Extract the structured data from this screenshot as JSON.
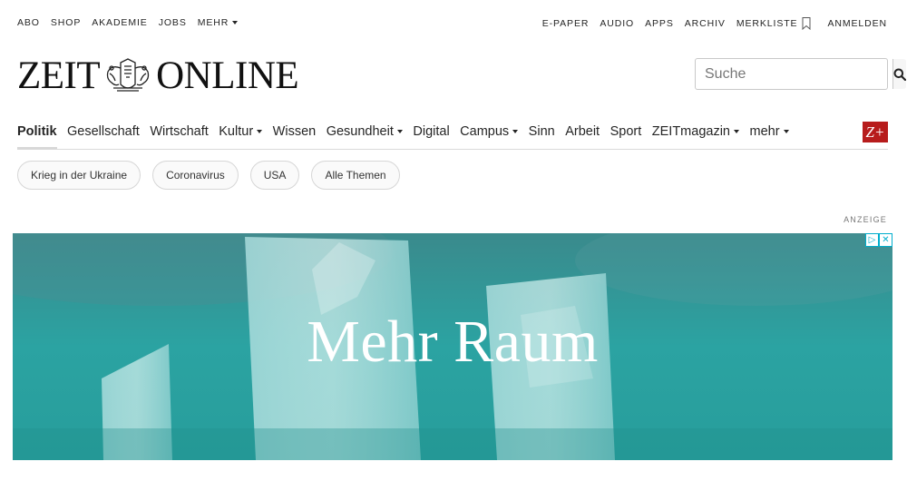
{
  "topbar": {
    "left": [
      "ABO",
      "SHOP",
      "AKADEMIE",
      "JOBS"
    ],
    "left_more": "MEHR",
    "right": [
      "E-PAPER",
      "AUDIO",
      "APPS",
      "ARCHIV"
    ],
    "merkliste": "MERKLISTE",
    "login": "ANMELDEN"
  },
  "logo": {
    "left": "ZEIT",
    "right": "ONLINE"
  },
  "search": {
    "placeholder": "Suche"
  },
  "nav": {
    "items": [
      {
        "label": "Politik",
        "dropdown": false,
        "active": true
      },
      {
        "label": "Gesellschaft",
        "dropdown": false
      },
      {
        "label": "Wirtschaft",
        "dropdown": false
      },
      {
        "label": "Kultur",
        "dropdown": true
      },
      {
        "label": "Wissen",
        "dropdown": false
      },
      {
        "label": "Gesundheit",
        "dropdown": true
      },
      {
        "label": "Digital",
        "dropdown": false
      },
      {
        "label": "Campus",
        "dropdown": true
      },
      {
        "label": "Sinn",
        "dropdown": false
      },
      {
        "label": "Arbeit",
        "dropdown": false
      },
      {
        "label": "Sport",
        "dropdown": false
      },
      {
        "label": "ZEITmagazin",
        "dropdown": true
      },
      {
        "label": "mehr",
        "dropdown": true
      }
    ],
    "zplus": "Z+"
  },
  "tags": [
    "Krieg in der Ukraine",
    "Coronavirus",
    "USA",
    "Alle Themen"
  ],
  "ad": {
    "label": "ANZEIGE",
    "headline": "Mehr Raum"
  },
  "colors": {
    "zplus_bg": "#b71c1c",
    "ad_bg": "#2a9a99"
  }
}
